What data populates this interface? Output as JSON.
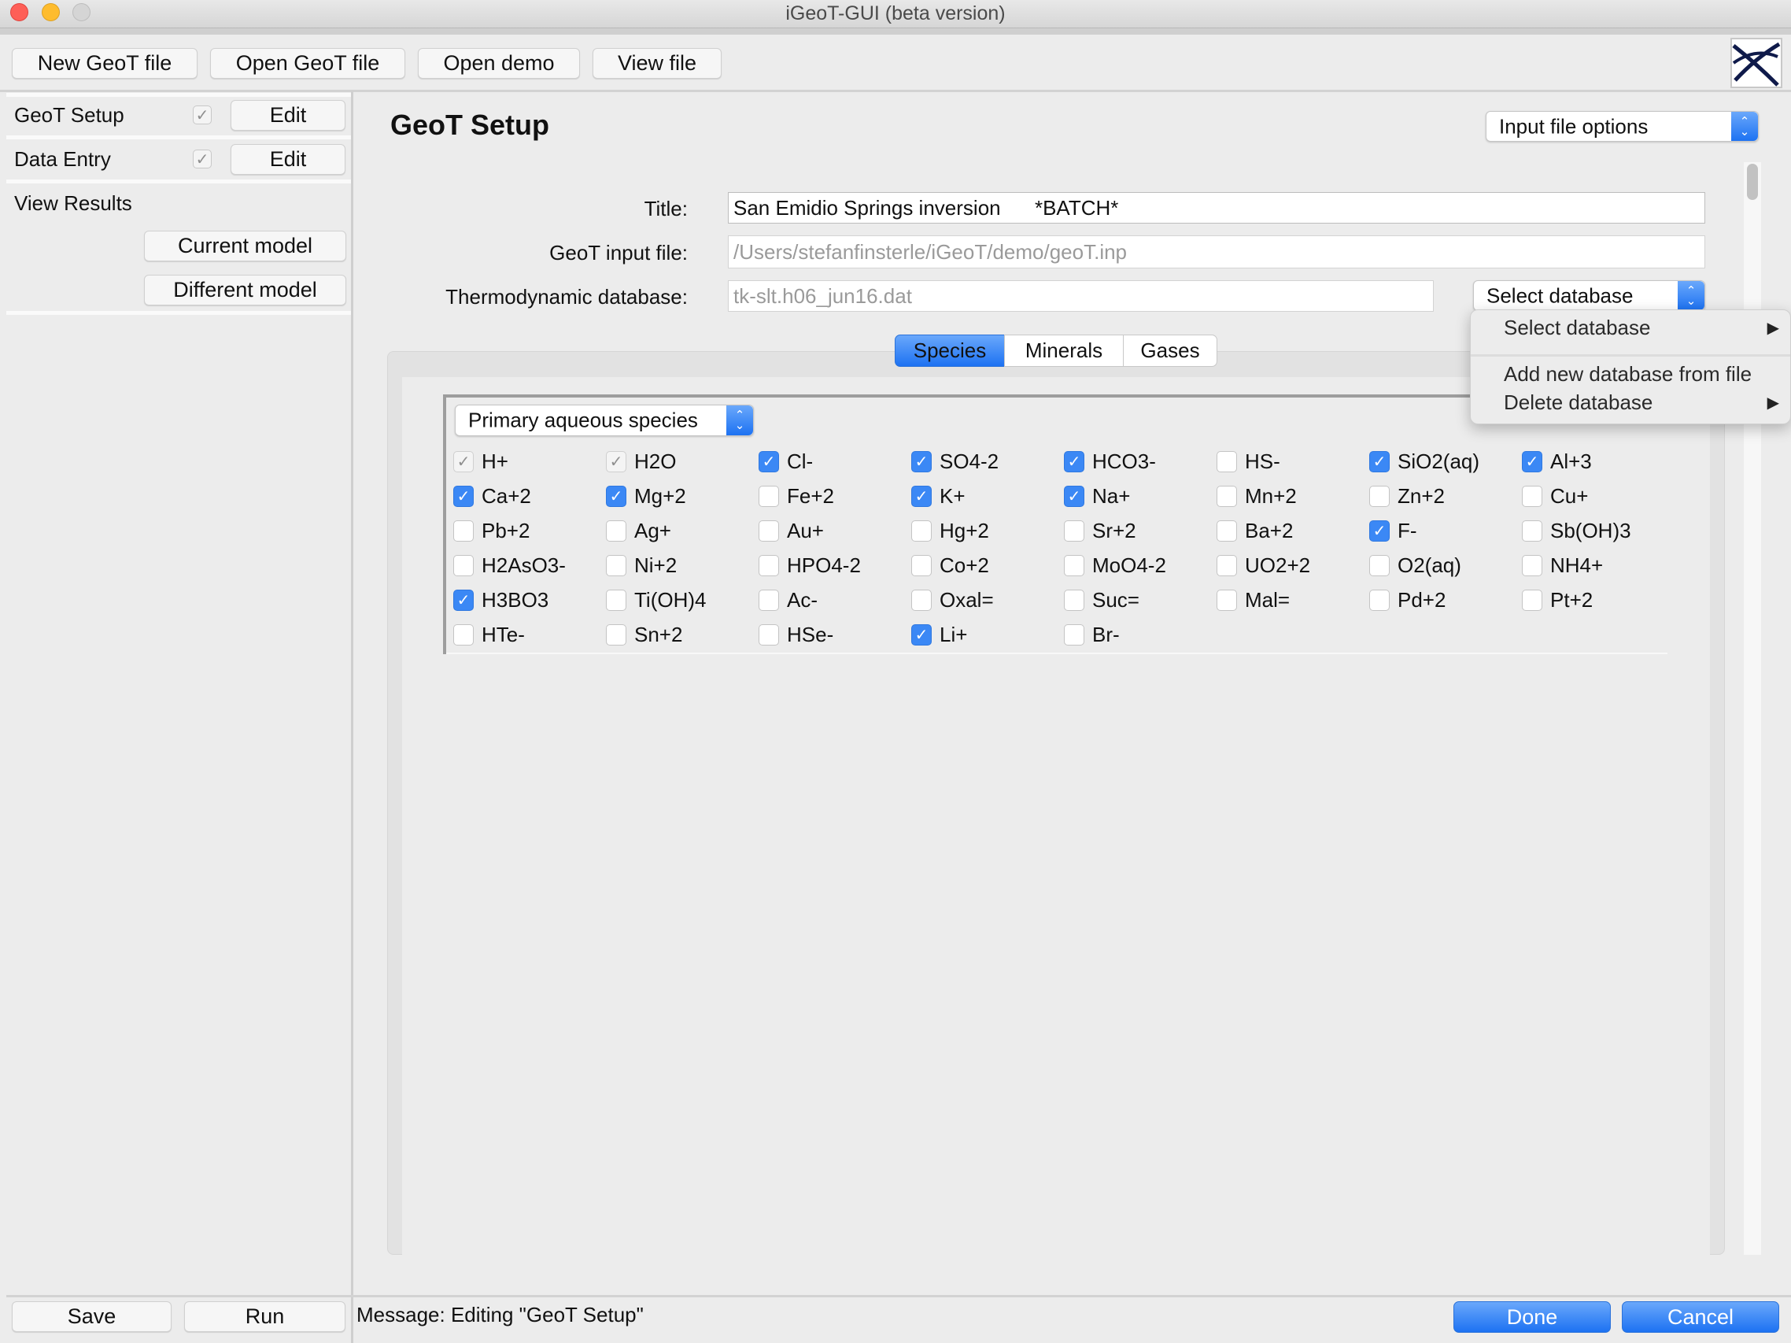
{
  "window": {
    "title": "iGeoT-GUI (beta version)"
  },
  "toolbar": {
    "buttons": [
      "New GeoT file",
      "Open GeoT file",
      "Open demo",
      "View file"
    ],
    "logo_icon": "igeot-logo-icon"
  },
  "sidebar": {
    "items": [
      {
        "label": "GeoT Setup",
        "checked": true,
        "edit_label": "Edit"
      },
      {
        "label": "Data Entry",
        "checked": true,
        "edit_label": "Edit"
      }
    ],
    "view_results": {
      "label": "View Results",
      "current_model": "Current model",
      "different_model": "Different model"
    }
  },
  "main": {
    "title": "GeoT Setup",
    "input_file_options": "Input file options",
    "form": {
      "title_label": "Title:",
      "title_value": "San Emidio Springs inversion      *BATCH*",
      "input_file_label": "GeoT input file:",
      "input_file_value": "/Users/stefanfinsterle/iGeoT/demo/geoT.inp",
      "database_label": "Thermodynamic database:",
      "database_value": "tk-slt.h06_jun16.dat",
      "select_database": "Select database"
    },
    "tabs": [
      {
        "label": "Species",
        "active": true
      },
      {
        "label": "Minerals",
        "active": false
      },
      {
        "label": "Gases",
        "active": false
      }
    ],
    "species_type": "Primary aqueous species",
    "species": [
      {
        "name": "H+",
        "state": "disabled-checked"
      },
      {
        "name": "H2O",
        "state": "disabled-checked"
      },
      {
        "name": "Cl-",
        "state": "checked"
      },
      {
        "name": "SO4-2",
        "state": "checked"
      },
      {
        "name": "HCO3-",
        "state": "checked"
      },
      {
        "name": "HS-",
        "state": "unchecked"
      },
      {
        "name": "SiO2(aq)",
        "state": "checked"
      },
      {
        "name": "Al+3",
        "state": "checked"
      },
      {
        "name": "Ca+2",
        "state": "checked"
      },
      {
        "name": "Mg+2",
        "state": "checked"
      },
      {
        "name": "Fe+2",
        "state": "unchecked"
      },
      {
        "name": "K+",
        "state": "checked"
      },
      {
        "name": "Na+",
        "state": "checked"
      },
      {
        "name": "Mn+2",
        "state": "unchecked"
      },
      {
        "name": "Zn+2",
        "state": "unchecked"
      },
      {
        "name": "Cu+",
        "state": "unchecked"
      },
      {
        "name": "Pb+2",
        "state": "unchecked"
      },
      {
        "name": "Ag+",
        "state": "unchecked"
      },
      {
        "name": "Au+",
        "state": "unchecked"
      },
      {
        "name": "Hg+2",
        "state": "unchecked"
      },
      {
        "name": "Sr+2",
        "state": "unchecked"
      },
      {
        "name": "Ba+2",
        "state": "unchecked"
      },
      {
        "name": "F-",
        "state": "checked"
      },
      {
        "name": "Sb(OH)3",
        "state": "unchecked"
      },
      {
        "name": "H2AsO3-",
        "state": "unchecked"
      },
      {
        "name": "Ni+2",
        "state": "unchecked"
      },
      {
        "name": "HPO4-2",
        "state": "unchecked"
      },
      {
        "name": "Co+2",
        "state": "unchecked"
      },
      {
        "name": "MoO4-2",
        "state": "unchecked"
      },
      {
        "name": "UO2+2",
        "state": "unchecked"
      },
      {
        "name": "O2(aq)",
        "state": "unchecked"
      },
      {
        "name": "NH4+",
        "state": "unchecked"
      },
      {
        "name": "H3BO3",
        "state": "checked"
      },
      {
        "name": "Ti(OH)4",
        "state": "unchecked"
      },
      {
        "name": "Ac-",
        "state": "unchecked"
      },
      {
        "name": "Oxal=",
        "state": "unchecked"
      },
      {
        "name": "Suc=",
        "state": "unchecked"
      },
      {
        "name": "Mal=",
        "state": "unchecked"
      },
      {
        "name": "Pd+2",
        "state": "unchecked"
      },
      {
        "name": "Pt+2",
        "state": "unchecked"
      },
      {
        "name": "HTe-",
        "state": "unchecked"
      },
      {
        "name": "Sn+2",
        "state": "unchecked"
      },
      {
        "name": "HSe-",
        "state": "unchecked"
      },
      {
        "name": "Li+",
        "state": "checked"
      },
      {
        "name": "Br-",
        "state": "unchecked"
      }
    ]
  },
  "database_menu": {
    "items": [
      {
        "label": "Select database",
        "submenu": true
      },
      {
        "label": "Add new database from file",
        "submenu": false
      },
      {
        "label": "Delete database",
        "submenu": true
      }
    ],
    "submenu_glyph": "▶"
  },
  "footer": {
    "save": "Save",
    "run": "Run",
    "message": "Message: Editing \"GeoT Setup\"",
    "done": "Done",
    "cancel": "Cancel"
  },
  "glyphs": {
    "check": "✓",
    "up": "⌃",
    "down": "⌄"
  },
  "colors": {
    "accent": "#1d72f2",
    "checkbox_on": "#3b88f5",
    "window_bg": "#ececec"
  }
}
